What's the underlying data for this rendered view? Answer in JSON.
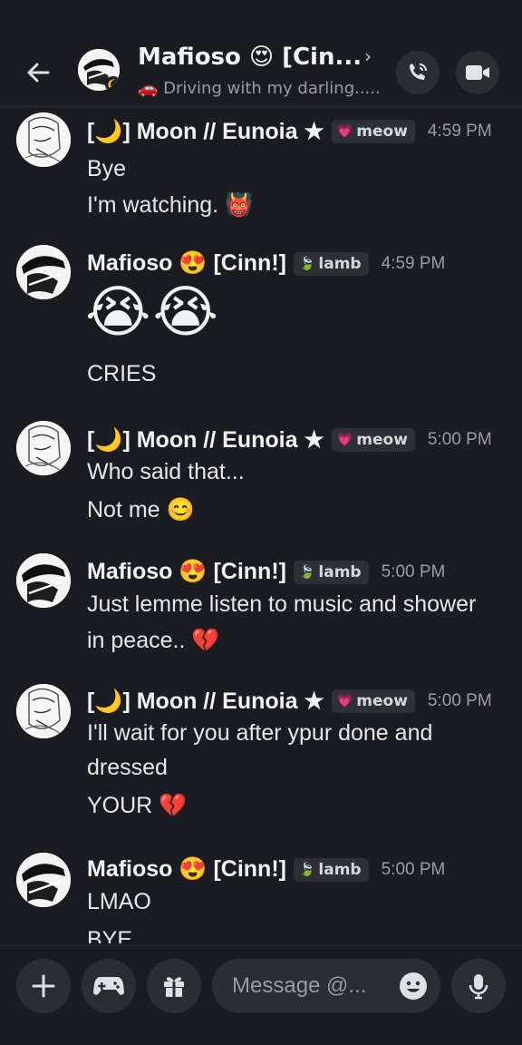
{
  "header": {
    "title": "Mafioso 😍 [Cin...",
    "chevron": "›",
    "subtitle": "🚗 Driving with my darling.....",
    "icons": [
      "back-arrow-icon",
      "voice-call-icon",
      "video-call-icon"
    ]
  },
  "messages": [
    {
      "author": "[🌙] Moon // Eunoia ★",
      "tag_icon": "💗",
      "tag": "meow",
      "time": "4:59 PM",
      "lines": [
        "Bye",
        "I'm watching. 👹"
      ]
    },
    {
      "author": "Mafioso 😍 [Cinn!]",
      "tag_icon": "🍃",
      "tag": "lamb",
      "time": "4:59 PM",
      "big_emoji": [
        "😭",
        "😭"
      ],
      "lines": [
        "CRIES"
      ]
    },
    {
      "author": "[🌙] Moon // Eunoia ★",
      "tag_icon": "💗",
      "tag": "meow",
      "time": "5:00 PM",
      "lines": [
        "Who said that...",
        "Not me 😊"
      ]
    },
    {
      "author": "Mafioso 😍 [Cinn!]",
      "tag_icon": "🍃",
      "tag": "lamb",
      "time": "5:00 PM",
      "lines": [
        "Just lemme listen to music and shower",
        "in peace.. 💔"
      ]
    },
    {
      "author": "[🌙] Moon // Eunoia ★",
      "tag_icon": "💗",
      "tag": "meow",
      "time": "5:00 PM",
      "lines": [
        "I'll wait for you after ypur done and",
        "dressed",
        "YOUR 💔"
      ]
    },
    {
      "author": "Mafioso 😍 [Cinn!]",
      "tag_icon": "🍃",
      "tag": "lamb",
      "time": "5:00 PM",
      "lines": [
        "LMAO",
        "BYE"
      ]
    }
  ],
  "composer": {
    "placeholder": "Message @...",
    "icons": [
      "plus-icon",
      "gamepad-icon",
      "gift-icon",
      "emoji-icon",
      "microphone-icon"
    ]
  },
  "colors": {
    "background": "#1b1c21",
    "button_bg": "#2b2d33",
    "tag_bg": "#2e3036",
    "text": "#f2f3f5",
    "muted": "#9b9ca3"
  }
}
